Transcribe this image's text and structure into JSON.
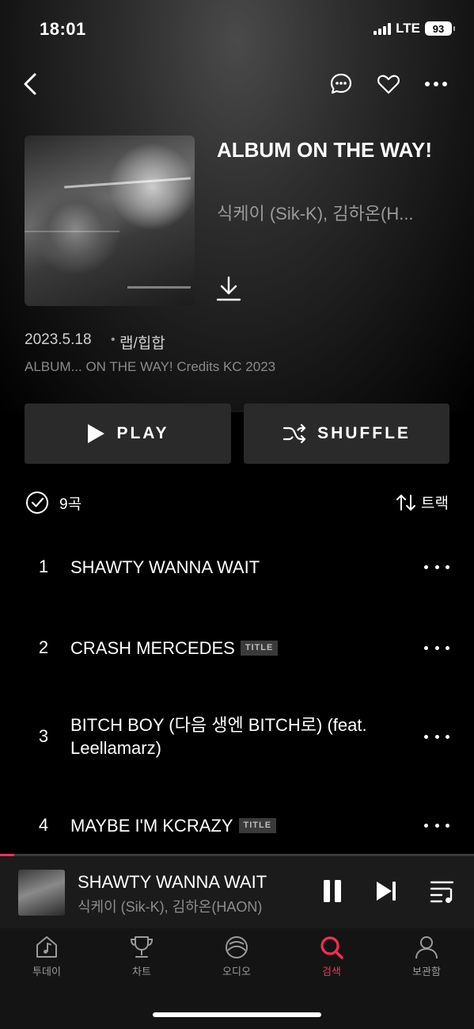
{
  "status_bar": {
    "time": "18:01",
    "network": "LTE",
    "battery": "93"
  },
  "top_nav": {
    "back": "back-icon",
    "actions": [
      "comment-icon",
      "heart-icon",
      "more-icon"
    ]
  },
  "album": {
    "title": "ALBUM ON THE WAY!",
    "artist": "식케이 (Sik-K), 김하온(H...",
    "date": "2023.5.18",
    "separator": "•",
    "genre": "랩/힙합",
    "credits": "ALBUM... ON THE WAY! Credits KC 2023"
  },
  "buttons": {
    "play": "PLAY",
    "shuffle": "SHUFFLE"
  },
  "tracklist": {
    "count": "9곡",
    "sort": "트랙",
    "tracks": [
      {
        "num": "1",
        "title": "SHAWTY WANNA WAIT",
        "badge": ""
      },
      {
        "num": "2",
        "title": "CRASH MERCEDES",
        "badge": "TITLE"
      },
      {
        "num": "3",
        "title": "BITCH BOY (다음 생엔 BITCH로) (feat. Leellamarz)",
        "badge": ""
      },
      {
        "num": "4",
        "title": "MAYBE I'M KCRAZY",
        "badge": "TITLE"
      }
    ]
  },
  "mini_player": {
    "title": "SHAWTY WANNA WAIT",
    "artist": "식케이 (Sik-K), 김하온(HAON)",
    "progress": 0.03
  },
  "tabs": [
    {
      "label": "투데이",
      "icon": "today-icon"
    },
    {
      "label": "차트",
      "icon": "trophy-icon"
    },
    {
      "label": "오디오",
      "icon": "audio-icon"
    },
    {
      "label": "검색",
      "icon": "search-icon",
      "active": true
    },
    {
      "label": "보관함",
      "icon": "profile-icon"
    }
  ],
  "colors": {
    "accent": "#fa2d55",
    "background": "#000000",
    "button": "#2a2a2a"
  }
}
